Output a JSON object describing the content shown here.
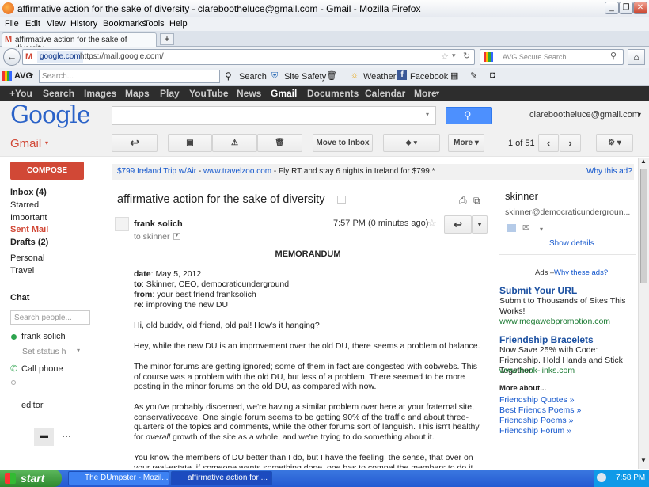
{
  "window": {
    "title": "affirmative action for the sake of diversity - clarebootheluce@gmail.com - Gmail - Mozilla Firefox"
  },
  "menu": [
    "File",
    "Edit",
    "View",
    "History",
    "Bookmarks",
    "Tools",
    "Help"
  ],
  "tab": {
    "label": "affirmative action for the sake of diversity - ...",
    "new": "+"
  },
  "nav": {
    "site": "google.com",
    "url": "https://mail.google.com/",
    "search_placeholder": "AVG Secure Search"
  },
  "avgbar": {
    "brand": "AVG",
    "search_placeholder": "Search...",
    "search": "Search",
    "site_safety": "Site Safety",
    "weather": "Weather",
    "facebook": "Facebook"
  },
  "gbar": [
    "+You",
    "Search",
    "Images",
    "Maps",
    "Play",
    "YouTube",
    "News",
    "Gmail",
    "Documents",
    "Calendar",
    "More"
  ],
  "account": {
    "email": "clarebootheluce@gmail.com",
    "logo": "Google",
    "app": "Gmail"
  },
  "toolbar": {
    "move": "Move to Inbox",
    "more": "More",
    "pager": "1 of 51"
  },
  "sidebar": {
    "compose": "COMPOSE",
    "items": [
      "Inbox (4)",
      "Starred",
      "Important",
      "Sent Mail",
      "Drafts (2)",
      "Personal",
      "Travel"
    ],
    "chat": "Chat",
    "people_placeholder": "Search people...",
    "me": "frank solich",
    "status": "Set status h",
    "call": "Call phone",
    "contact": "editor"
  },
  "ad": {
    "title": "$799 Ireland Trip w/Air",
    "sep": " - ",
    "site": "www.travelzoo.com",
    "text": " - Fly RT and stay 6 nights in Ireland for $799.*",
    "why": "Why this ad?"
  },
  "email": {
    "subject": "affirmative action for the sake of diversity",
    "from": "frank solich",
    "time": "7:57 PM (0 minutes ago)",
    "to": "to skinner",
    "heading": "MEMORANDUM",
    "date": "May 5, 2012",
    "to_line": "Skinner, CEO, democraticunderground",
    "from_line": "your best friend franksolich",
    "re": "improving the new DU",
    "lbl_date": "date",
    "lbl_to": "to",
    "lbl_from": "from",
    "lbl_re": "re",
    "p1": "Hi, old buddy, old friend, old pal!  How's it hanging?",
    "p2": "Hey, while the new DU is an improvement over the old DU, there seems a problem of balance.",
    "p3": "The minor forums are getting ignored; some of them in fact are congested with cobwebs.  This of course was a problem with the old DU, but less of a problem.  There seemed to be more posting in the minor forums on the old DU, as compared with now.",
    "p4a": "As you've probably discerned, we're having a similar problem over here at your fraternal site, conservativecave.  One single forum seems to be getting 90% of the traffic and about three-quarters of the topics and comments, while the other forums sort of languish.  This isn't healthy for ",
    "p4b": "overall",
    "p4c": " growth of the site as a whole, and we're trying to do something about it.",
    "p5": "You know the members of DU better than I do, but I have the feeling, the sense, that over on your real-estate, if someone wants something done, one has to compel the members to do it"
  },
  "contact": {
    "name": "skinner",
    "email": "skinner@democraticundergroun...",
    "details": "Show details"
  },
  "ads": {
    "label": "Ads – ",
    "why": "Why these ads?",
    "a1": {
      "title": "Submit Your URL",
      "text": "Submit to Thousands of Sites This Works!",
      "url": "www.megawebpromotion.com"
    },
    "a2": {
      "title": "Friendship Bracelets",
      "text": "Now Save 25% with Code: Friendship. Hold Hands and Stick Together!",
      "url": "www.hook-links.com"
    },
    "more": "More about...",
    "links": [
      "Friendship Quotes »",
      "Best Friends Poems »",
      "Friendship Poems »",
      "Friendship Forum »"
    ]
  },
  "taskbar": {
    "start": "start",
    "t1": "The DUmpster - Mozil...",
    "t2": "affirmative action for ...",
    "clock": "7:58 PM"
  }
}
